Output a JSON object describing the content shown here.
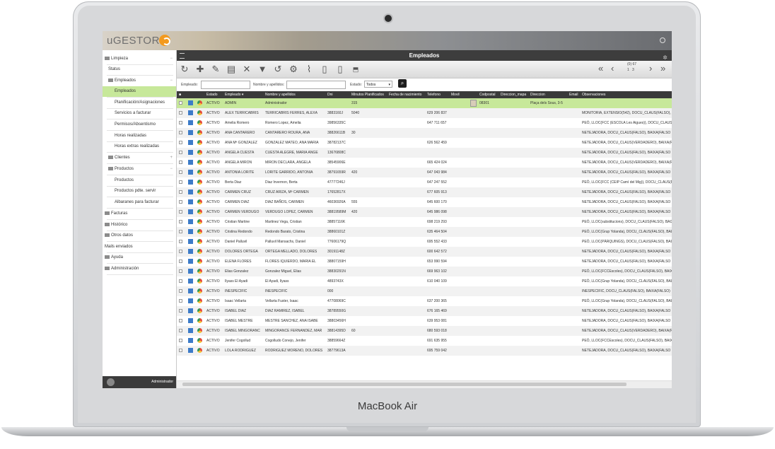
{
  "device": {
    "brand": "MacBook Air"
  },
  "app": {
    "logo": "uGESTOR",
    "power_icon": "power-icon"
  },
  "sidebar": {
    "items": [
      {
        "label": "Limpieza",
        "level": 0,
        "folder": true,
        "toggle": "−"
      },
      {
        "label": "Status",
        "level": 1
      },
      {
        "label": "Empleados",
        "level": 1,
        "folder": true,
        "toggle": "−"
      },
      {
        "label": "Empleados",
        "level": 2,
        "selected": true
      },
      {
        "label": "Planificación/Asignaciones",
        "level": 2
      },
      {
        "label": "Servicios a facturar",
        "level": 2
      },
      {
        "label": "Permisos/Absentismo",
        "level": 2
      },
      {
        "label": "Horas realizadas",
        "level": 2
      },
      {
        "label": "Horas extras realizadas",
        "level": 2
      },
      {
        "label": "Clientes",
        "level": 1,
        "folder": true,
        "toggle": "+"
      },
      {
        "label": "Productos",
        "level": 1,
        "folder": true,
        "toggle": "−"
      },
      {
        "label": "Productos",
        "level": 2
      },
      {
        "label": "Productos pdte. servir",
        "level": 2
      },
      {
        "label": "Albaranes para facturar",
        "level": 2
      },
      {
        "label": "Facturas",
        "level": 0,
        "folder": true
      },
      {
        "label": "Histórico",
        "level": 0,
        "folder": true
      },
      {
        "label": "Otros datos",
        "level": 0,
        "folder": true
      },
      {
        "label": "Mails enviados",
        "level": 0
      },
      {
        "label": "Ayuda",
        "level": 0,
        "folder": true
      },
      {
        "label": "Administración",
        "level": 0,
        "folder": true
      }
    ],
    "user": "Administrador"
  },
  "main": {
    "title": "Empleados",
    "pager": {
      "total": "(0) 67",
      "pages": [
        "1",
        "3"
      ]
    },
    "filters": {
      "empleado_label": "Empleado:",
      "nombre_label": "Nombre y apellidos:",
      "estado_label": "Estado:",
      "estado_value": "Todos"
    },
    "columns": [
      "Estado",
      "Empleado ▾",
      "Nombre y apellidos",
      "Dni",
      "Minutos Planificados",
      "Fecha de nacimiento",
      "Telefono",
      "Movil",
      "Codpostal",
      "Direccion_mapa",
      "Direccion",
      "Email",
      "Observaciones"
    ],
    "rows": [
      {
        "estado": "ACTIVO",
        "empleado": "ADMIN",
        "nombre": "Administrador",
        "dni": "",
        "minutos": "315",
        "telefono": "",
        "codpostal": "08301",
        "direccion": "Plaça dels Sous, 3-5",
        "obs": "",
        "selected": true
      },
      {
        "estado": "ACTIVO",
        "empleado": "ALEX TERRICABRIS",
        "nombre": "TERRICABRIS FERRES, ALEXA",
        "dni": "3883160J",
        "minutos": "5040",
        "telefono": "629 206 837",
        "obs": "MONITORIA, EXTENSIO(542), DOCU_CLAUS(FALSO), BAIXA(FALSO"
      },
      {
        "estado": "ACTIVO",
        "empleado": "Amelia Romero",
        "nombre": "Romero Lopez, Amelia",
        "dni": "39856335C",
        "minutos": "",
        "telefono": "647 711 657",
        "obs": "PEÓ, LLOC(FCC (ESCOLA Les Aigues)), DOCU_CLAUS(FALSO), BAIXA(F"
      },
      {
        "estado": "ACTIVO",
        "empleado": "ANA CANTARERO",
        "nombre": "CANTARERO ROURA, ANA",
        "dni": "38826611B",
        "minutos": "30",
        "telefono": "",
        "obs": "NETEJADORA, DOCU_CLAUS(FALSO), BAIXA(FALSO"
      },
      {
        "estado": "ACTIVO",
        "empleado": "ANA Mª GONZALEZ",
        "nombre": "GONZALEZ MATEO, ANA MARIA",
        "dni": "38782137C",
        "minutos": "",
        "telefono": "626 562 459",
        "obs": "NETEJADORA, DOCU_CLAUS(VERDADERO), BAIXA(F"
      },
      {
        "estado": "ACTIVO",
        "empleado": "ANGELA CUESTA",
        "nombre": "CUESTA ALEGRE, MARIA ANGE",
        "dni": "13676808C",
        "minutos": "",
        "telefono": "",
        "obs": "NETEJADORA, DOCU_CLAUS(FALSO), BAIXA(FALSO"
      },
      {
        "estado": "ACTIVO",
        "empleado": "ANGELA MIRON",
        "nombre": "MIRON DECLARA, ANGELA",
        "dni": "38545906E",
        "minutos": "",
        "telefono": "665 424 024",
        "obs": "NETEJADORA, DOCU_CLAUS(VERDADERO), BAIXA(F"
      },
      {
        "estado": "ACTIVO",
        "empleado": "ANTONIA LORITE",
        "nombre": "LORITE GARRIDO, ANTONIA",
        "dni": "38791659R",
        "minutos": "420",
        "telefono": "647 043 984",
        "obs": "NETEJADORA, DOCU_CLAUS(FALSO), BAIXA(FALSO"
      },
      {
        "estado": "ACTIVO",
        "empleado": "Berta Diaz",
        "nombre": "Diaz Invernon, Berta",
        "dni": "47777246J",
        "minutos": "",
        "telefono": "647 247 552",
        "obs": "PEÓ, LLOC(FCC (CEIP Camí del Mig)), DOCU_CLAUS(FALSO), BAIXA"
      },
      {
        "estado": "ACTIVO",
        "empleado": "CARMEN CRUZ",
        "nombre": "CRUZ ARIZA, Mª CARMEN",
        "dni": "17652817X",
        "minutos": "",
        "telefono": "677 605 913",
        "obs": "NETEJADORA, DOCU_CLAUS(FALSO), BAIXA(FALSO"
      },
      {
        "estado": "ACTIVO",
        "empleado": "CARMEN DIAZ",
        "nombre": "DIAZ BAÑOS, CARMEN",
        "dni": "46036926A",
        "minutos": "555",
        "telefono": "645 600 170",
        "obs": "NETEJADORA, DOCU_CLAUS(FALSO), BAIXA(FALSO"
      },
      {
        "estado": "ACTIVO",
        "empleado": "CARMEN VERDUGO",
        "nombre": "VERDUGO LOPEZ, CARMEN",
        "dni": "38819589M",
        "minutos": "420",
        "telefono": "645 986 098",
        "obs": "NETEJADORA, DOCU_CLAUS(FALSO), BAIXA(FALSO"
      },
      {
        "estado": "ACTIVO",
        "empleado": "Cristian Martine",
        "nombre": "Martinez Vega, Cristian",
        "dni": "38857116K",
        "minutos": "",
        "telefono": "698 219 293",
        "obs": "PEÓ, LLOC(substitucions), DOCU_CLAUS(FALSO), BAIXA(FALSO"
      },
      {
        "estado": "ACTIVO",
        "empleado": "Cristina Redondo",
        "nombre": "Redondo Barato, Cristina",
        "dni": "38860101Z",
        "minutos": "",
        "telefono": "635 464 504",
        "obs": "PEÓ, LLOC(Grup Yolanda), DOCU_CLAUS(FALSO), BAIX"
      },
      {
        "estado": "ACTIVO",
        "empleado": "Daniel Palluvil",
        "nombre": "Palluvil Mansachs, Daniel",
        "dni": "77606179Q",
        "minutos": "",
        "telefono": "695 552 433",
        "obs": "PEÓ, LLOC(PÀRQUINGS), DOCU_CLAUS(FALSO), BAIX"
      },
      {
        "estado": "ACTIVO",
        "empleado": "DOLORES ORTEGA",
        "nombre": "ORTEGA MELLADO, DOLORES",
        "dni": "30191148Z",
        "minutos": "",
        "telefono": "600 642 572",
        "obs": "NETEJADORA, DOCU_CLAUS(FALSO), BAIXA(FALSO"
      },
      {
        "estado": "ACTIVO",
        "empleado": "ELENA FLORES",
        "nombre": "FLORES IQUIERDO, MARIA EL",
        "dni": "38807159H",
        "minutos": "",
        "telefono": "653 990 594",
        "obs": "NETEJADORA, DOCU_CLAUS(FALSO), BAIXA(FALSO"
      },
      {
        "estado": "ACTIVO",
        "empleado": "Elias Gonzalez",
        "nombre": "Gonzalez Miguel, Elias",
        "dni": "38830291N",
        "minutos": "",
        "telefono": "669 963 102",
        "obs": "PEÓ, LLOC(FCCEscoles), DOCU_CLAUS(FALSO), BAIX"
      },
      {
        "estado": "ACTIVO",
        "empleado": "Ilyass El Ayadi",
        "nombre": "El Ayadi, Ilyass",
        "dni": "4893743X",
        "minutos": "",
        "telefono": "610 040 109",
        "obs": "PEÓ, LLOC(Grup Yolanda), DOCU_CLAUS(FALSO), BAIX"
      },
      {
        "estado": "ACTIVO",
        "empleado": "INESPECIFIC",
        "nombre": "INESPECIFIC",
        "dni": "000",
        "minutos": "",
        "telefono": "",
        "obs": "INESPECIFIC, DOCU_CLAUS(FALSO), BAIXA(FALSO)"
      },
      {
        "estado": "ACTIVO",
        "empleado": "Isaac Vellarta",
        "nombre": "Vellarta Fuster, Isaac",
        "dni": "47708069C",
        "minutos": "",
        "telefono": "637 200 365",
        "obs": "PEÓ, LLOC(Grup Yolanda), DOCU_CLAUS(FALSO), BAIX"
      },
      {
        "estado": "ACTIVO",
        "empleado": "ISABEL DIAZ",
        "nombre": "DIAZ RAMIREZ, ISABEL",
        "dni": "38789550G",
        "minutos": "",
        "telefono": "676 165 469",
        "obs": "NETEJADORA, DOCU_CLAUS(FALSO), BAIXA(FALSO"
      },
      {
        "estado": "ACTIVO",
        "empleado": "ISABEL MESTRE",
        "nombre": "MESTRE SANCHEZ, ANA ISABE",
        "dni": "38803456H",
        "minutos": "",
        "telefono": "639 953 081",
        "obs": "NETEJADORA, DOCU_CLAUS(FALSO), BAIXA(FALSO"
      },
      {
        "estado": "ACTIVO",
        "empleado": "ISABEL MINGORANC",
        "nombre": "MINGORANCE FERNANDEZ, MAR",
        "dni": "38814395D",
        "minutos": "60",
        "telefono": "680 593 018",
        "obs": "NETEJADORA, DOCU_CLAUS(VERDADERO), BAIXA(F"
      },
      {
        "estado": "ACTIVO",
        "empleado": "Jenifer Cogollud",
        "nombre": "Cogolludo Conejo, Jenifer",
        "dni": "38859664Z",
        "minutos": "",
        "telefono": "691 635 955",
        "obs": "PEÓ, LLOC(FCCEscoles), DOCU_CLAUS(FALSO), BAIXA(FALSO"
      },
      {
        "estado": "ACTIVO",
        "empleado": "LOLA RODRIGUEZ",
        "nombre": "RODRIGUEZ MORENO, DOLORES",
        "dni": "38779613A",
        "minutos": "",
        "telefono": "695 759 042",
        "obs": "NETEJADORA, DOCU_CLAUS(FALSO), BAIXA(FALSO"
      }
    ]
  }
}
